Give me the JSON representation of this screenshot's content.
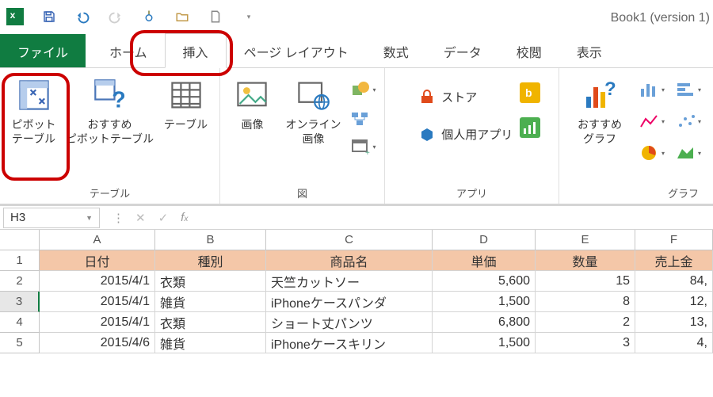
{
  "app": {
    "title": "Book1 (version 1)"
  },
  "tabs": {
    "file": "ファイル",
    "home": "ホーム",
    "insert": "挿入",
    "layout": "ページ レイアウト",
    "formulas": "数式",
    "data": "データ",
    "review": "校閲",
    "view": "表示"
  },
  "ribbon": {
    "tables": {
      "pivot": "ピボット\nテーブル",
      "rec_pivot": "おすすめ\nピボットテーブル",
      "table": "テーブル",
      "group": "テーブル"
    },
    "illust": {
      "picture": "画像",
      "online": "オンライン\n画像",
      "group": "図"
    },
    "apps": {
      "store": "ストア",
      "myapps": "個人用アプリ",
      "group": "アプリ"
    },
    "charts": {
      "recommended": "おすすめ\nグラフ",
      "group": "グラフ"
    }
  },
  "fbar": {
    "cellref": "H3"
  },
  "columns": [
    "A",
    "B",
    "C",
    "D",
    "E",
    "F"
  ],
  "headers": [
    "日付",
    "種別",
    "商品名",
    "単価",
    "数量",
    "売上金"
  ],
  "rows": [
    {
      "n": 2,
      "date": "2015/4/1",
      "cat": "衣類",
      "name": "天竺カットソー",
      "price": "5,600",
      "qty": "15",
      "sales": "84,"
    },
    {
      "n": 3,
      "date": "2015/4/1",
      "cat": "雑貨",
      "name": "iPhoneケースパンダ",
      "price": "1,500",
      "qty": "8",
      "sales": "12,"
    },
    {
      "n": 4,
      "date": "2015/4/1",
      "cat": "衣類",
      "name": "ショート丈パンツ",
      "price": "6,800",
      "qty": "2",
      "sales": "13,"
    },
    {
      "n": 5,
      "date": "2015/4/6",
      "cat": "雑貨",
      "name": "iPhoneケースキリン",
      "price": "1,500",
      "qty": "3",
      "sales": "4,"
    }
  ]
}
